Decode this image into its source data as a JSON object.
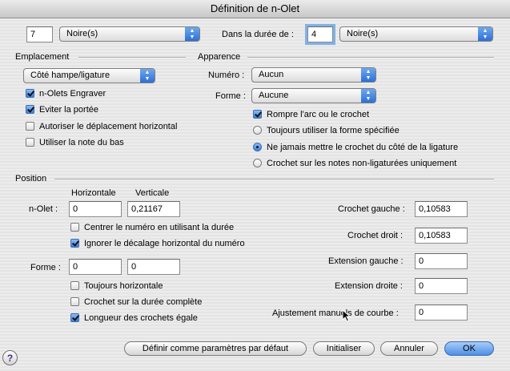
{
  "window": {
    "title": "Définition de n-Olet"
  },
  "top": {
    "count_value": "7",
    "count_unit": "Noire(s)",
    "duration_label": "Dans la durée de :",
    "duration_value": "4",
    "duration_unit": "Noire(s)"
  },
  "emplacement": {
    "heading": "Emplacement",
    "position_popup": "Côté hampe/ligature",
    "checkboxes": [
      {
        "label": "n-Olets Engraver",
        "checked": true
      },
      {
        "label": "Eviter la portée",
        "checked": true
      },
      {
        "label": "Autoriser le déplacement horizontal",
        "checked": false
      },
      {
        "label": "Utiliser la note du bas",
        "checked": false
      }
    ]
  },
  "apparence": {
    "heading": "Apparence",
    "numero_label": "Numéro :",
    "numero_value": "Aucun",
    "forme_label": "Forme :",
    "forme_value": "Aucune",
    "break_slur": {
      "label": "Rompre l'arc ou le crochet",
      "checked": true
    },
    "radios": [
      {
        "label": "Toujours utiliser la forme spécifiée",
        "selected": false
      },
      {
        "label": "Ne jamais mettre le crochet du côté de la ligature",
        "selected": true
      },
      {
        "label": "Crochet sur les notes non-ligaturées uniquement",
        "selected": false
      }
    ]
  },
  "position": {
    "heading": "Position",
    "col_horizontal": "Horizontale",
    "col_vertical": "Verticale",
    "nolet_label": "n-Olet :",
    "nolet_h": "0",
    "nolet_v": "0,21167",
    "center_number": {
      "label": "Centrer le numéro en utilisant la durée",
      "checked": false
    },
    "ignore_offset": {
      "label": "Ignorer le décalage horizontal du numéro",
      "checked": true
    },
    "forme_label": "Forme :",
    "forme_h": "0",
    "forme_v": "0",
    "always_horizontal": {
      "label": "Toujours horizontale",
      "checked": false
    },
    "full_duration": {
      "label": "Crochet sur la durée complète",
      "checked": false
    },
    "equal_lengths": {
      "label": "Longueur des crochets égale",
      "checked": true
    },
    "left_hook_label": "Crochet gauche :",
    "left_hook_value": "0,10583",
    "right_hook_label": "Crochet droit :",
    "right_hook_value": "0,10583",
    "left_ext_label": "Extension gauche :",
    "left_ext_value": "0",
    "right_ext_label": "Extension droite :",
    "right_ext_value": "0",
    "curve_adjust_label": "Ajustement manuels de courbe :",
    "curve_adjust_value": "0"
  },
  "buttons": {
    "help": "?",
    "set_default": "Définir comme paramètres par défaut",
    "reset": "Initialiser",
    "cancel": "Annuler",
    "ok": "OK"
  },
  "icons": {
    "popup_arrow": "up-down-arrows-icon",
    "cursor": "mouse-pointer-icon"
  }
}
